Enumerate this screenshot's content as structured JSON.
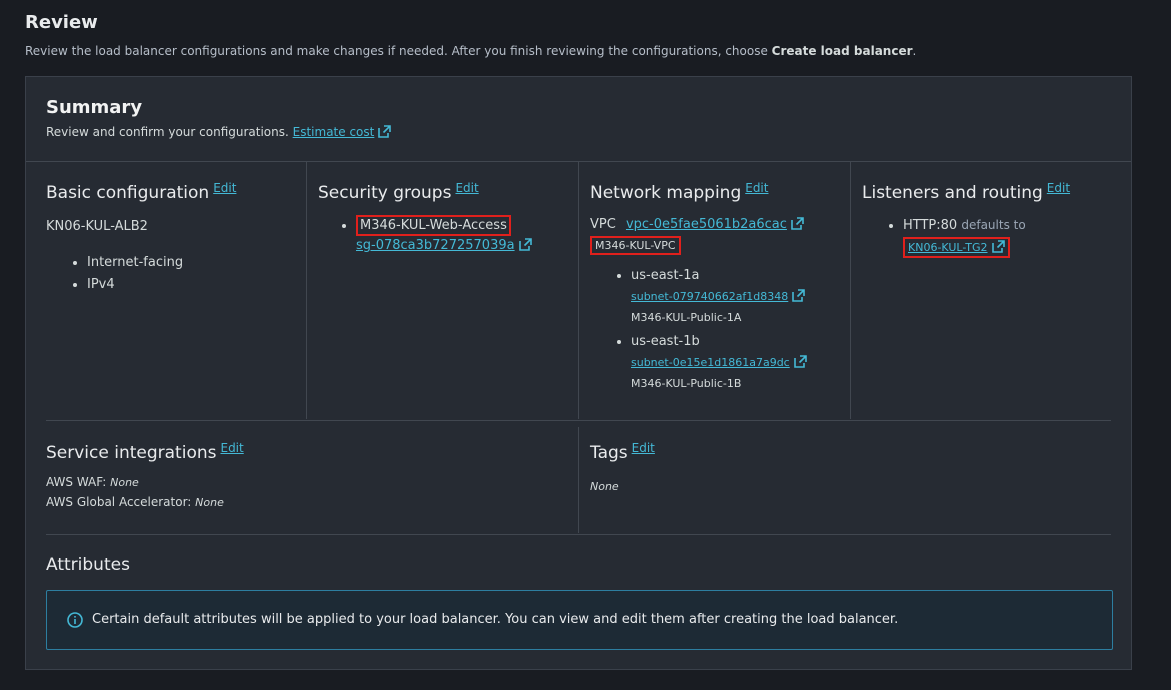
{
  "review": {
    "title": "Review",
    "desc_pre": "Review the load balancer configurations and make changes if needed. After you finish reviewing the configurations, choose ",
    "desc_bold": "Create load balancer",
    "desc_post": "."
  },
  "summary": {
    "title": "Summary",
    "desc": "Review and confirm your configurations.",
    "estimate_link": "Estimate cost"
  },
  "edit_label": "Edit",
  "basic": {
    "title": "Basic configuration",
    "name": "KN06-KUL-ALB2",
    "items": [
      "Internet-facing",
      "IPv4"
    ]
  },
  "security": {
    "title": "Security groups",
    "group_name": "M346-KUL-Web-Access",
    "group_id": "sg-078ca3b727257039a"
  },
  "network": {
    "title": "Network mapping",
    "vpc_label": "VPC",
    "vpc_id": "vpc-0e5fae5061b2a6cac",
    "vpc_name": "M346-KUL-VPC",
    "zones": [
      {
        "az": "us-east-1a",
        "subnet": "subnet-079740662af1d8348",
        "subnet_name": "M346-KUL-Public-1A"
      },
      {
        "az": "us-east-1b",
        "subnet": "subnet-0e15e1d1861a7a9dc",
        "subnet_name": "M346-KUL-Public-1B"
      }
    ]
  },
  "listeners": {
    "title": "Listeners and routing",
    "listener": "HTTP:80",
    "defaults_to": "defaults to",
    "target_group": "KN06-KUL-TG2"
  },
  "service": {
    "title": "Service integrations",
    "waf_label": "AWS WAF:",
    "waf_value": "None",
    "ga_label": "AWS Global Accelerator:",
    "ga_value": "None"
  },
  "tags": {
    "title": "Tags",
    "value": "None"
  },
  "attributes": {
    "title": "Attributes",
    "info": "Certain default attributes will be applied to your load balancer. You can view and edit them after creating the load balancer."
  },
  "colors": {
    "link": "#44b9d6",
    "highlight": "#e0201c",
    "info_border": "#2d7ea0"
  }
}
